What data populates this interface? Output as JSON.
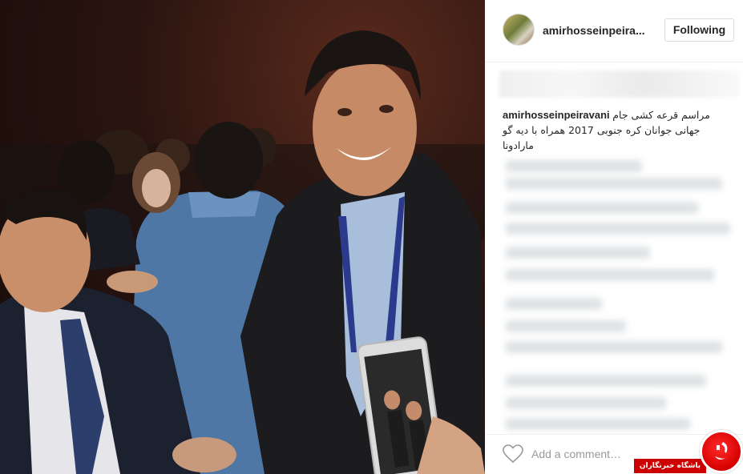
{
  "header": {
    "username": "amirhosseinpeira...",
    "follow_label": "Following"
  },
  "caption": {
    "username": "amirhosseinpeiravani",
    "text": "مراسم قرعه کشی جام جهانی جوانان کره جنوبی 2017 همراه با دیه گو مارادونا"
  },
  "comment_box": {
    "placeholder": "Add a comment…"
  },
  "watermark": {
    "text": "باشگاه خبرنگاران"
  },
  "icons": {
    "like": "heart-icon",
    "avatar": "profile-avatar"
  },
  "colors": {
    "text": "#262626",
    "border": "#dbdbdb",
    "placeholder": "#999999",
    "watermark": "#cc0000"
  }
}
